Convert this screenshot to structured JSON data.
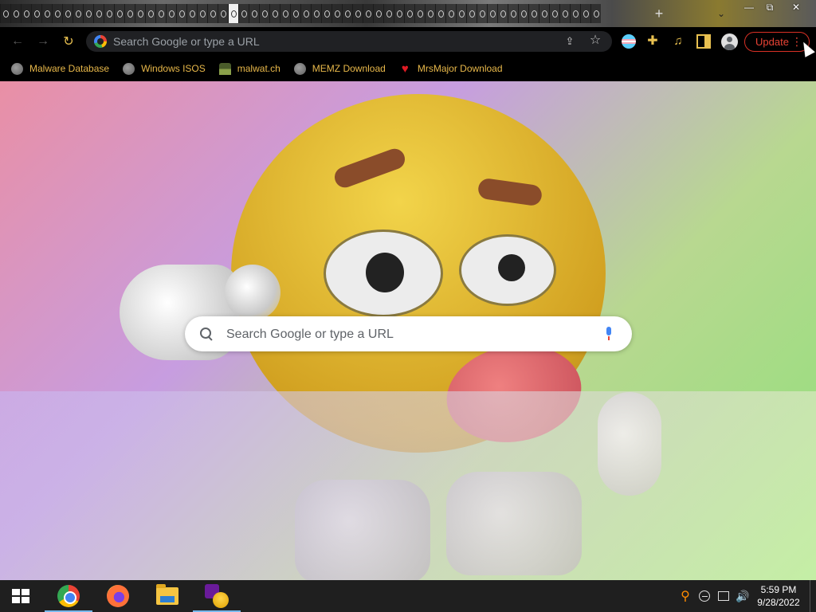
{
  "browser": {
    "omnibox_placeholder": "Search Google or type a URL",
    "update_label": "Update",
    "menu_glyph": "⋮",
    "accent_color": "#e8c050",
    "update_color": "#ea4335",
    "icons": [
      "back-icon",
      "forward-icon",
      "reload-icon",
      "google-icon",
      "share-icon",
      "star-icon",
      "trans-flag-extension-icon",
      "puzzle-icon",
      "media-icon",
      "side-panel-icon",
      "profile-icon",
      "menu-icon"
    ]
  },
  "tabstrip": {
    "tab_count": 58,
    "new_tab_glyph": "+",
    "tab_search_glyph": "⌄",
    "window_controls": {
      "minimize": "—",
      "maximize": "⧉",
      "close": "✕"
    }
  },
  "bookmarks": [
    {
      "label": "Malware Database",
      "icon": "globe-icon"
    },
    {
      "label": "Windows ISOS",
      "icon": "globe-icon"
    },
    {
      "label": "malwat.ch",
      "icon": "hacker-icon"
    },
    {
      "label": "MEMZ Download",
      "icon": "globe-icon"
    },
    {
      "label": "MrsMajor Download",
      "icon": "heart-icon"
    }
  ],
  "newtab": {
    "search_placeholder": "Search Google or type a URL",
    "background_description_colors": [
      "#e98fa5",
      "#c79de0",
      "#b8d890",
      "#8fe07a"
    ]
  },
  "taskbar": {
    "apps": [
      {
        "name": "chrome-icon",
        "running": true
      },
      {
        "name": "firefox-icon",
        "running": false
      },
      {
        "name": "file-explorer-icon",
        "running": false
      },
      {
        "name": "yahoo-messenger-icon",
        "running": true
      }
    ],
    "clock": {
      "time": "5:59 PM",
      "date": "9/28/2022"
    },
    "volume_glyph": "🔊",
    "search_glyph": "⚲"
  }
}
